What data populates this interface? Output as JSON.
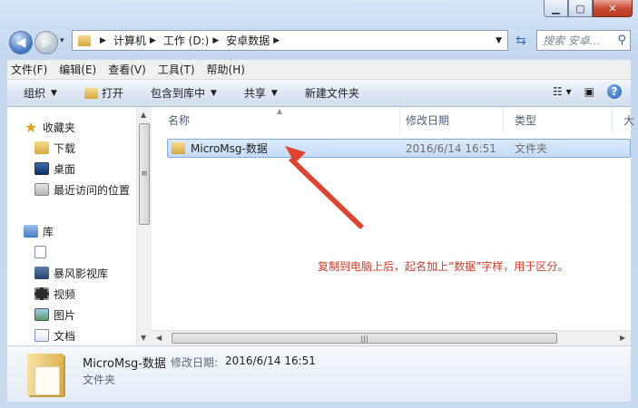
{
  "window": {
    "controls": {
      "minimize": "▁",
      "maximize": "▢",
      "close": "✕"
    }
  },
  "address": {
    "crumbs": [
      "计算机",
      "工作 (D:)",
      "安卓数据"
    ],
    "search_placeholder": "搜索 安卓..."
  },
  "menubar": {
    "items": [
      "文件(F)",
      "编辑(E)",
      "查看(V)",
      "工具(T)",
      "帮助(H)"
    ]
  },
  "toolbar": {
    "organize": "组织",
    "open": "打开",
    "include_in_library": "包含到库中",
    "share": "共享",
    "new_folder": "新建文件夹"
  },
  "navpane": {
    "favorites": "收藏夹",
    "downloads": "下载",
    "desktop": "桌面",
    "recent": "最近访问的位置",
    "libraries": "库",
    "storm_video": "暴风影视库",
    "videos": "视频",
    "pictures": "图片",
    "documents": "文档"
  },
  "columns": {
    "name": "名称",
    "date_modified": "修改日期",
    "type": "类型",
    "size_partial": "大"
  },
  "files": [
    {
      "name": "MicroMsg-数据",
      "date": "2016/6/14 16:51",
      "type": "文件夹"
    }
  ],
  "annotation": "复制到电脑上后，起名加上“数据”字样，用于区分。",
  "details": {
    "name": "MicroMsg-数据",
    "date_label": "修改日期:",
    "date": "2016/6/14 16:51",
    "type": "文件夹"
  },
  "colors": {
    "annotation": "#d23b2b",
    "selection": "#c4dcf7",
    "accent": "#3a6fb5"
  }
}
